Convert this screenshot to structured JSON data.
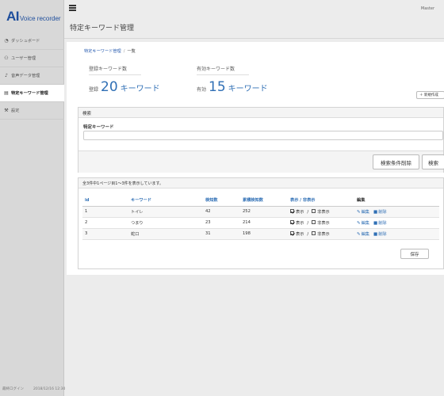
{
  "app": {
    "logo_main": "AI",
    "logo_sub": "Voice recorder",
    "user": "Master"
  },
  "sidebar": {
    "items": [
      {
        "label": "ダッシュボード",
        "icon": "dashboard-icon",
        "glyph": "◔"
      },
      {
        "label": "ユーザー管理",
        "icon": "users-icon",
        "glyph": "👥"
      },
      {
        "label": "音声データ管理",
        "icon": "microphone-icon",
        "glyph": "🎙"
      },
      {
        "label": "特定キーワード管理",
        "icon": "document-icon",
        "glyph": "▤"
      },
      {
        "label": "設定",
        "icon": "wrench-icon",
        "glyph": "🔧"
      }
    ],
    "active_index": 3,
    "footer_label": "最終ログイン",
    "footer_time": "2018/12/16 12:30"
  },
  "page": {
    "title": "特定キーワード管理"
  },
  "breadcrumb": {
    "parent": "特定キーワード管理",
    "separator": "/",
    "current": "一覧"
  },
  "stats": {
    "registered": {
      "label": "登録キーワード数",
      "prefix": "登録",
      "value": "20",
      "suffix": "キーワード"
    },
    "enabled": {
      "label": "有効キーワード数",
      "prefix": "有効",
      "value": "15",
      "suffix": "キーワード"
    }
  },
  "new_button": {
    "icon": "plus-icon",
    "label": "＋ 新規作成"
  },
  "search": {
    "header": "検索",
    "field_label": "特定キーワード",
    "field_value": "",
    "clear_label": "検索条件削除",
    "submit_label": "検索"
  },
  "results": {
    "summary": "全3件中1ページ目1〜3件を表示しています。",
    "columns": [
      "id",
      "キーワード",
      "検知数",
      "累積検知数",
      "表示 / 非表示",
      "編集"
    ],
    "rows": [
      {
        "id": "1",
        "keyword": "トイレ",
        "count": "42",
        "total": "252",
        "show": true
      },
      {
        "id": "2",
        "keyword": "つまり",
        "count": "23",
        "total": "214",
        "show": true
      },
      {
        "id": "3",
        "keyword": "蛇口",
        "count": "31",
        "total": "198",
        "show": true
      }
    ],
    "show_label": "表示",
    "hide_label": "非表示",
    "edit_label": "編集",
    "delete_label": "削除",
    "save_label": "保存"
  }
}
